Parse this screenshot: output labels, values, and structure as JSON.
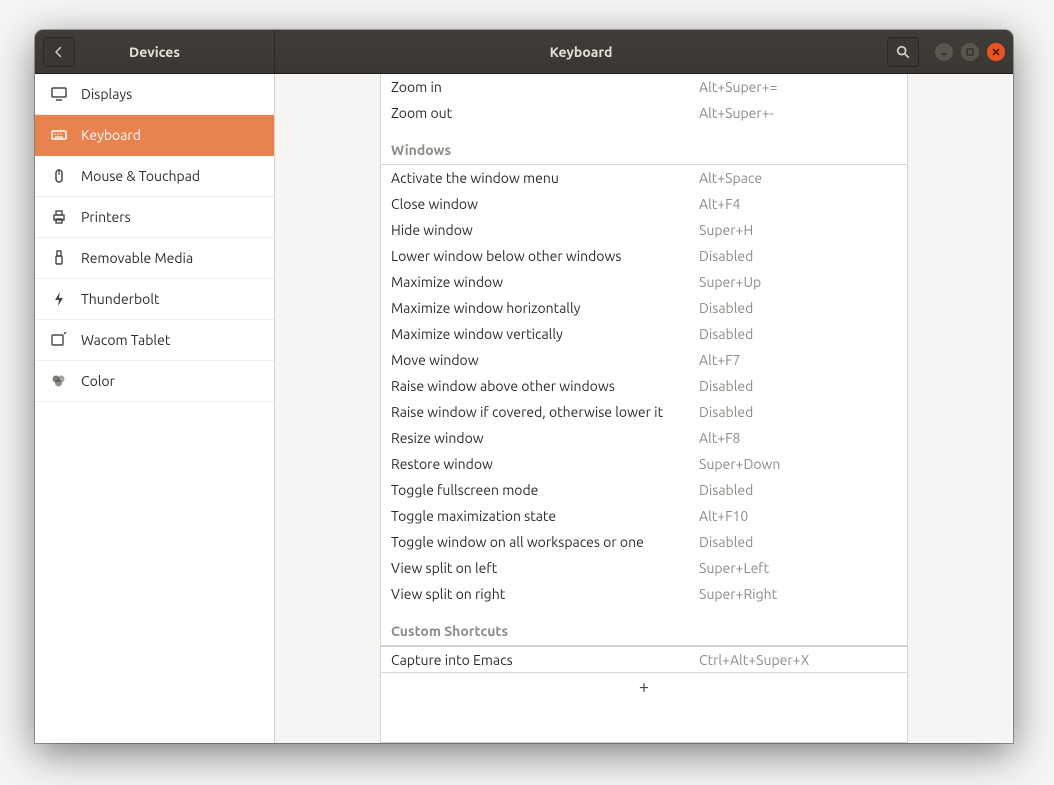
{
  "titlebar": {
    "left_title": "Devices",
    "center_title": "Keyboard"
  },
  "sidebar": {
    "items": [
      {
        "icon": "display",
        "label": "Displays"
      },
      {
        "icon": "keyboard",
        "label": "Keyboard"
      },
      {
        "icon": "mouse",
        "label": "Mouse & Touchpad"
      },
      {
        "icon": "printer",
        "label": "Printers"
      },
      {
        "icon": "usb",
        "label": "Removable Media"
      },
      {
        "icon": "thunderbolt",
        "label": "Thunderbolt"
      },
      {
        "icon": "tablet",
        "label": "Wacom Tablet"
      },
      {
        "icon": "color",
        "label": "Color"
      }
    ],
    "selected_index": 1
  },
  "sections": [
    {
      "header": null,
      "rows": [
        {
          "label": "Zoom in",
          "value": "Alt+Super+="
        },
        {
          "label": "Zoom out",
          "value": "Alt+Super+-"
        }
      ]
    },
    {
      "header": "Windows",
      "rows": [
        {
          "label": "Activate the window menu",
          "value": "Alt+Space"
        },
        {
          "label": "Close window",
          "value": "Alt+F4"
        },
        {
          "label": "Hide window",
          "value": "Super+H"
        },
        {
          "label": "Lower window below other windows",
          "value": "Disabled"
        },
        {
          "label": "Maximize window",
          "value": "Super+Up"
        },
        {
          "label": "Maximize window horizontally",
          "value": "Disabled"
        },
        {
          "label": "Maximize window vertically",
          "value": "Disabled"
        },
        {
          "label": "Move window",
          "value": "Alt+F7"
        },
        {
          "label": "Raise window above other windows",
          "value": "Disabled"
        },
        {
          "label": "Raise window if covered, otherwise lower it",
          "value": "Disabled"
        },
        {
          "label": "Resize window",
          "value": "Alt+F8"
        },
        {
          "label": "Restore window",
          "value": "Super+Down"
        },
        {
          "label": "Toggle fullscreen mode",
          "value": "Disabled"
        },
        {
          "label": "Toggle maximization state",
          "value": "Alt+F10"
        },
        {
          "label": "Toggle window on all workspaces or one",
          "value": "Disabled"
        },
        {
          "label": "View split on left",
          "value": "Super+Left"
        },
        {
          "label": "View split on right",
          "value": "Super+Right"
        }
      ]
    },
    {
      "header": "Custom Shortcuts",
      "rows": [
        {
          "label": "Capture into Emacs",
          "value": "Ctrl+Alt+Super+X"
        }
      ],
      "add_button": "+"
    }
  ]
}
